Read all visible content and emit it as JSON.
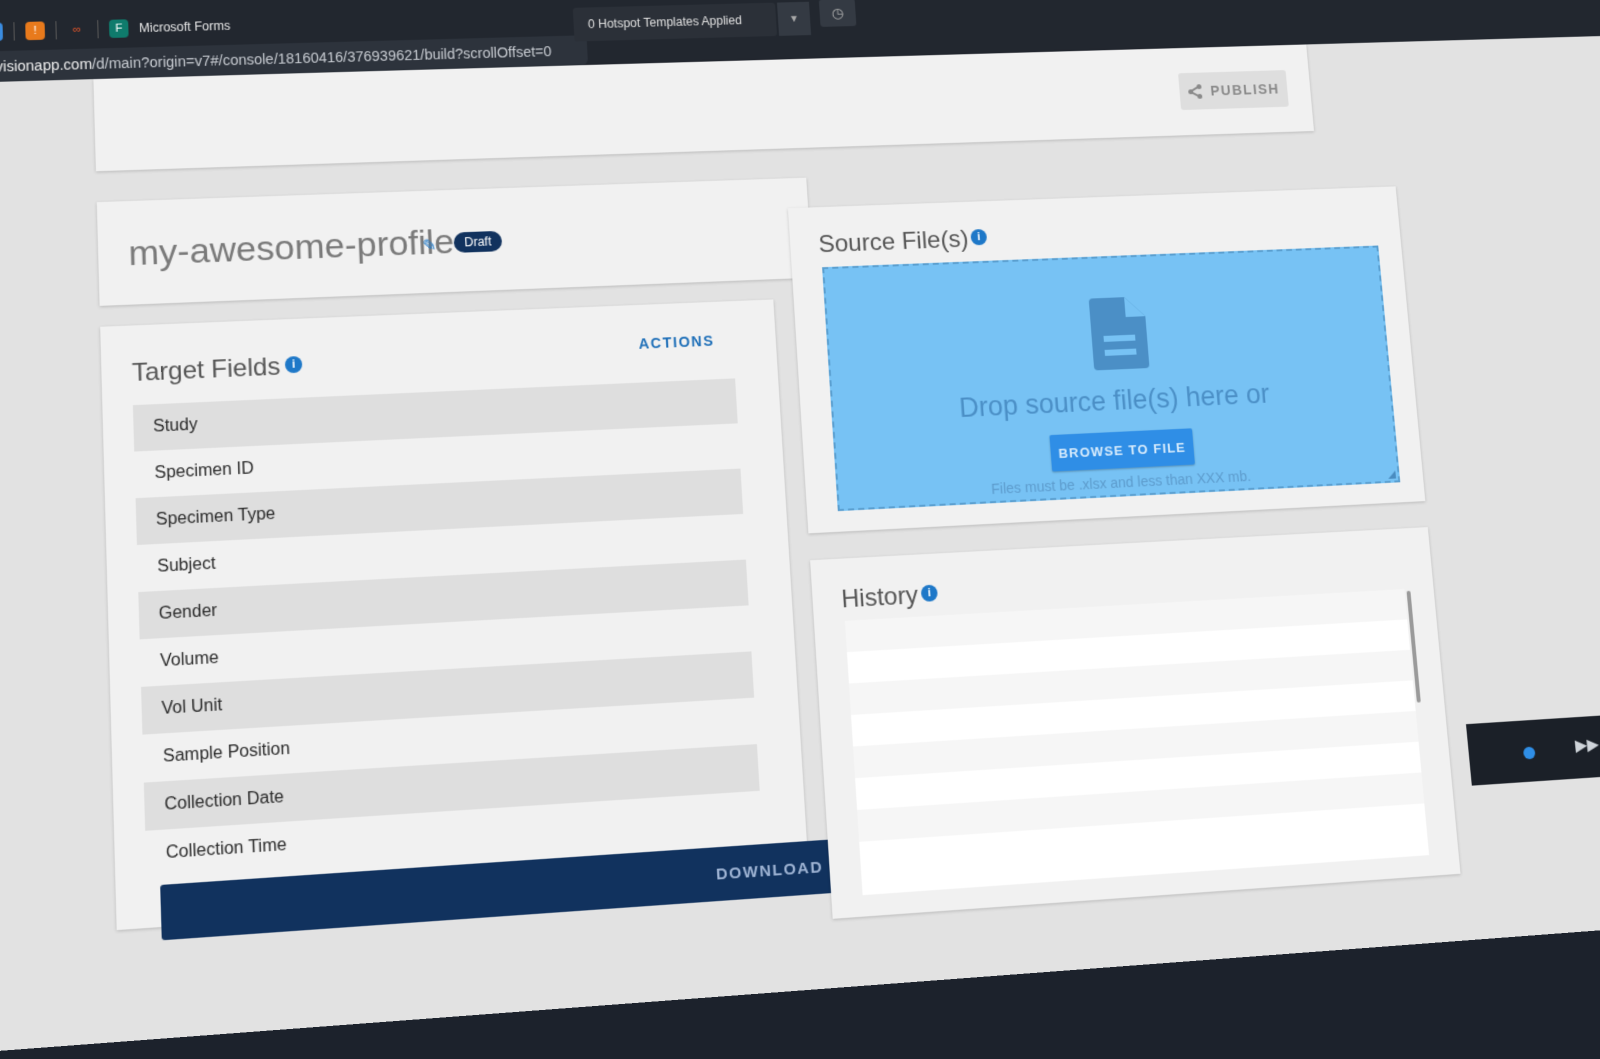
{
  "browser": {
    "tab_title": "Microsoft Forms",
    "url_host": "jects.invisionapp.com",
    "url_path": "/d/main?origin=v7#/console/18160416/376939621/build?scrollOffset=0",
    "hotspot_label": "0 Hotspot Templates Applied"
  },
  "header": {
    "publish_label": "PUBLISH"
  },
  "profile": {
    "name": "my-awesome-profile",
    "status_badge": "Draft"
  },
  "target_fields": {
    "actions_label": "ACTIONS",
    "title": "Target Fields",
    "info_glyph": "i",
    "items": [
      {
        "label": "Study"
      },
      {
        "label": "Specimen ID"
      },
      {
        "label": "Specimen Type"
      },
      {
        "label": "Subject"
      },
      {
        "label": "Gender"
      },
      {
        "label": "Volume"
      },
      {
        "label": "Vol Unit"
      },
      {
        "label": "Sample Position"
      },
      {
        "label": "Collection Date"
      },
      {
        "label": "Collection Time"
      }
    ],
    "download_label": "DOWNLOAD"
  },
  "source_files": {
    "title": "Source File(s)",
    "info_glyph": "i",
    "drop_text": "Drop source file(s) here or",
    "browse_label": "BROWSE TO FILE",
    "hint": "Files must be .xlsx and less than XXX mb."
  },
  "history": {
    "title": "History",
    "info_glyph": "i"
  },
  "colors": {
    "brand_navy": "#11325e",
    "accent_blue": "#1e78c8",
    "dropzone_fill": "#77c2f4",
    "browse_button": "#2f8ee6"
  },
  "icons": [
    "share-icon",
    "edit-pencil-icon",
    "info-icon",
    "document-icon",
    "history-icon"
  ]
}
